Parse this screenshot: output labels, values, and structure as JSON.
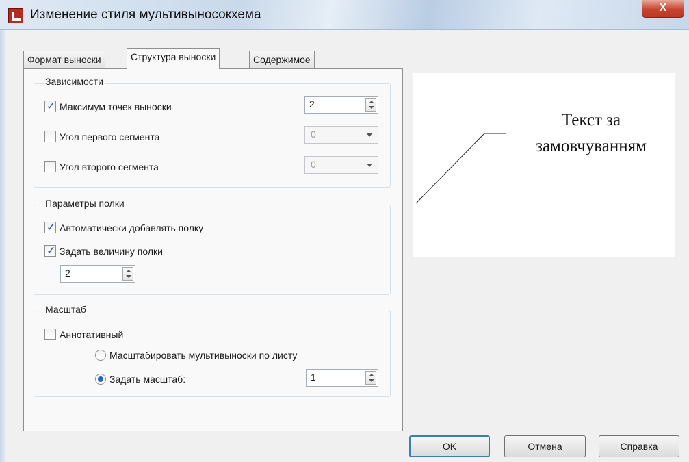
{
  "window": {
    "title": "Изменение стиля мультивыносокхема",
    "close_label": "X"
  },
  "tabs": [
    {
      "label": "Формат выноски"
    },
    {
      "label": "Структура выноски"
    },
    {
      "label": "Содержимое"
    }
  ],
  "active_tab": "Структура выноски",
  "dependencies": {
    "title": "Зависимости",
    "max_points": {
      "label": "Максимум точек выноски",
      "checked": true,
      "value": "2"
    },
    "first_segment_angle": {
      "label": "Угол первого сегмента",
      "checked": false,
      "value": "0"
    },
    "second_segment_angle": {
      "label": "Угол второго сегмента",
      "checked": false,
      "value": "0"
    }
  },
  "landing": {
    "title": "Параметры полки",
    "auto_add": {
      "label": "Автоматически добавлять полку",
      "checked": true
    },
    "set_distance": {
      "label": "Задать величину полки",
      "checked": true,
      "value": "2"
    }
  },
  "scale": {
    "title": "Масштаб",
    "annotative": {
      "label": "Аннотативный",
      "checked": false
    },
    "scale_to_layout": {
      "label": "Масштабировать мультивыноски по листу",
      "selected": false
    },
    "specify_scale": {
      "label": "Задать масштаб:",
      "selected": true,
      "value": "1"
    }
  },
  "preview": {
    "line1": "Текст за",
    "line2": "замовчуванням"
  },
  "buttons": {
    "ok": "OK",
    "cancel": "Отмена",
    "help": "Справка"
  }
}
